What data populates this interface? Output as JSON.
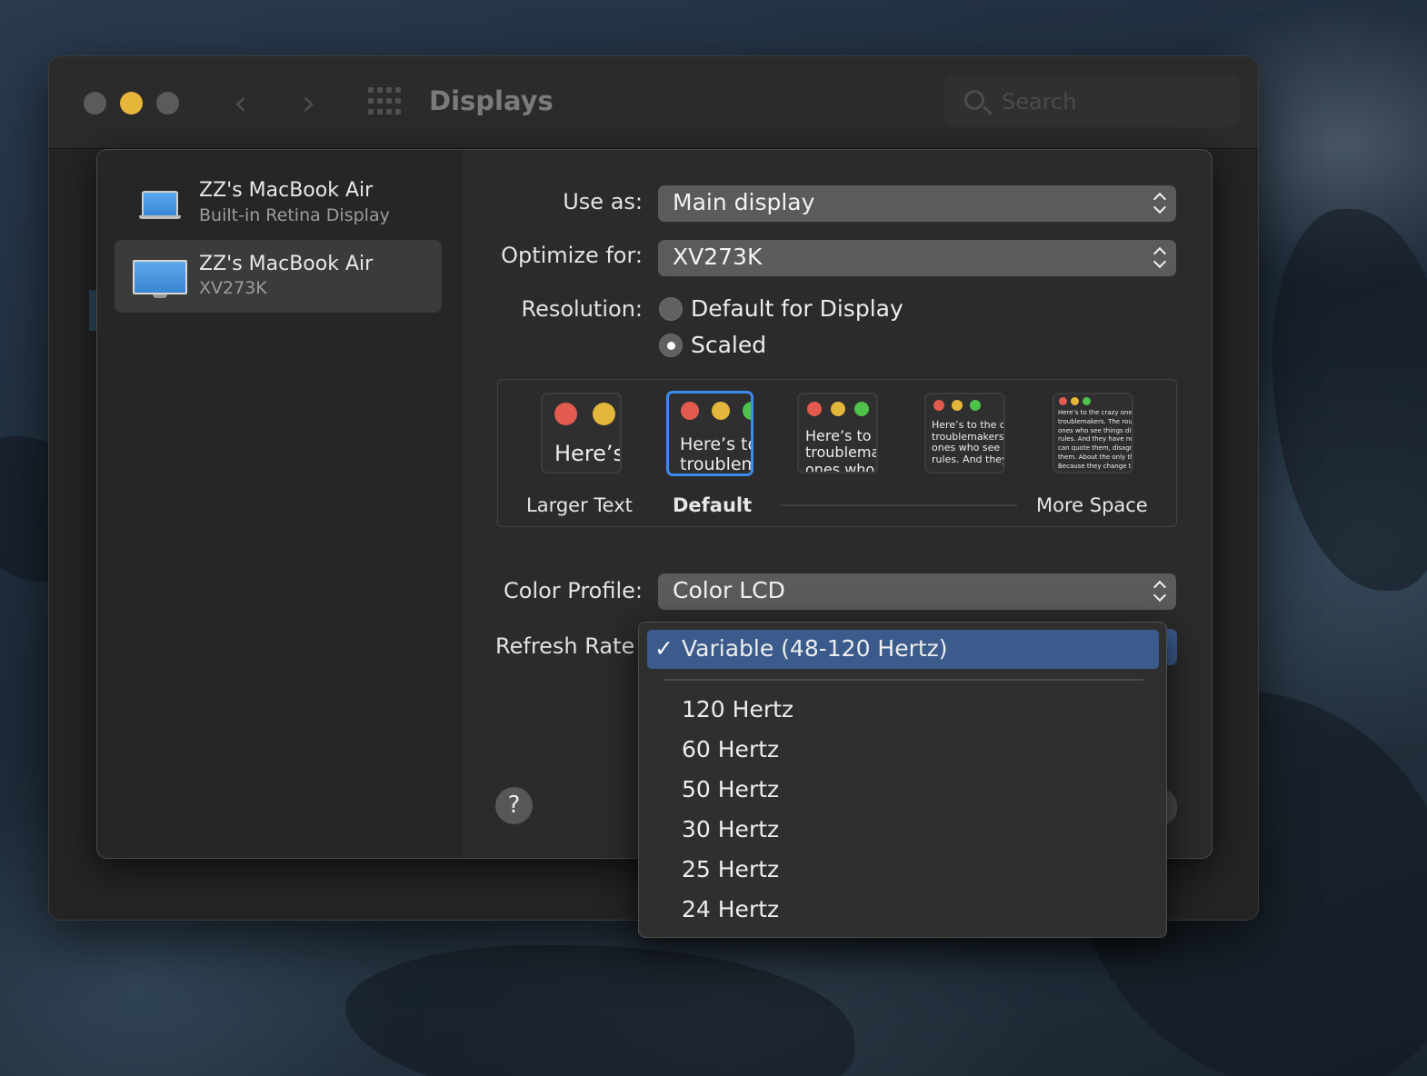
{
  "window": {
    "title": "Displays",
    "search_placeholder": "Search",
    "help_label": "?"
  },
  "sidebar": {
    "items": [
      {
        "name": "ZZ's MacBook Air",
        "subtitle": "Built-in Retina Display",
        "icon": "laptop-icon",
        "selected": false
      },
      {
        "name": "ZZ's MacBook Air",
        "subtitle": "XV273K",
        "icon": "monitor-icon",
        "selected": true
      }
    ]
  },
  "settings": {
    "use_as": {
      "label": "Use as:",
      "value": "Main display"
    },
    "optimize_for": {
      "label": "Optimize for:",
      "value": "XV273K"
    },
    "resolution": {
      "label": "Resolution:",
      "options": [
        {
          "label": "Default for Display",
          "checked": false
        },
        {
          "label": "Scaled",
          "checked": true
        }
      ]
    },
    "scaling": {
      "options": [
        {
          "preview_text": "Here’s"
        },
        {
          "preview_text": "Here’s to\ntroublem"
        },
        {
          "preview_text": "Here’s to t\ntroublema\nones who"
        },
        {
          "preview_text": "Here’s to the cr\ntroublemakers.\nones who see t\nrules. And they"
        },
        {
          "preview_text": "Here’s to the crazy one\ntroublemakers. The rou\nones who see things dif\nrules. And they have no\ncan quote them, disagr\nthem. About the only th\nBecause they change th"
        }
      ],
      "selected_index": 1,
      "labels": {
        "larger": "Larger Text",
        "default": "Default",
        "more": "More Space"
      }
    },
    "color_profile": {
      "label": "Color Profile:",
      "value": "Color LCD"
    },
    "refresh_rate": {
      "label": "Refresh Rate"
    }
  },
  "refresh_menu": {
    "items": [
      {
        "label": "Variable (48-120 Hertz)",
        "checked": true
      },
      {
        "label": "120 Hertz",
        "checked": false
      },
      {
        "label": "60 Hertz",
        "checked": false
      },
      {
        "label": "50 Hertz",
        "checked": false
      },
      {
        "label": "30 Hertz",
        "checked": false
      },
      {
        "label": "25 Hertz",
        "checked": false
      },
      {
        "label": "24 Hertz",
        "checked": false
      }
    ],
    "check_glyph": "✓"
  },
  "colors": {
    "accent": "#3d8bf0",
    "menu_highlight": "#3b5b8c",
    "traffic_minimize": "#e6b63a"
  }
}
